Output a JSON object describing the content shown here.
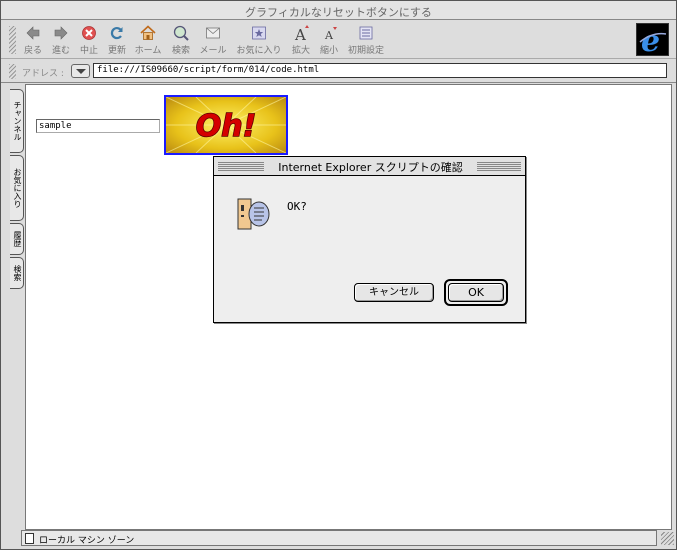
{
  "window": {
    "title": "グラフィカルなリセットボタンにする"
  },
  "toolbar": {
    "buttons": [
      {
        "label": "戻る",
        "icon": "back-arrow-icon"
      },
      {
        "label": "進む",
        "icon": "forward-arrow-icon"
      },
      {
        "label": "中止",
        "icon": "stop-icon"
      },
      {
        "label": "更新",
        "icon": "refresh-icon"
      },
      {
        "label": "ホーム",
        "icon": "home-icon"
      },
      {
        "label": "検索",
        "icon": "search-icon"
      },
      {
        "label": "メール",
        "icon": "mail-icon"
      },
      {
        "label": "お気に入り",
        "icon": "favorites-icon"
      },
      {
        "label": "拡大",
        "icon": "text-larger-icon"
      },
      {
        "label": "縮小",
        "icon": "text-smaller-icon"
      },
      {
        "label": "初期設定",
        "icon": "preferences-icon"
      }
    ]
  },
  "address": {
    "label": "アドレス :",
    "url": "file:///IS09660/script/form/014/code.html"
  },
  "sidetabs": [
    "チャンネル",
    "お気に入り",
    "履歴",
    "検索"
  ],
  "page": {
    "input_value": "sample",
    "image_button_text": "Oh!"
  },
  "status": {
    "zone": "ローカル マシン ゾーン"
  },
  "dialog": {
    "title": "Internet Explorer スクリプトの確認",
    "message": "OK?",
    "cancel_label": "キャンセル",
    "ok_label": "OK"
  },
  "colors": {
    "window_bg": "#dddddd",
    "content_bg": "#ffffff",
    "image_button_border": "#1a1aff",
    "image_button_bg": "#e8c21a",
    "image_button_text": "#d40000"
  }
}
